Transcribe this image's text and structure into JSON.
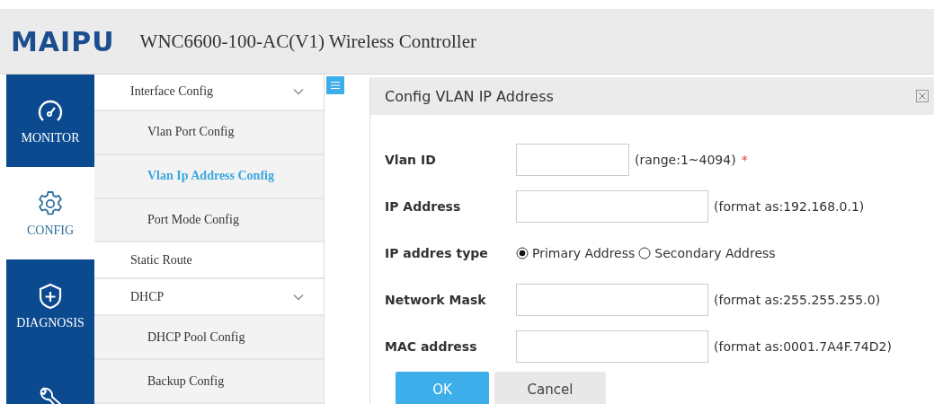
{
  "header": {
    "logo": "MAIPU",
    "title": "WNC6600-100-AC(V1) Wireless Controller"
  },
  "rail": [
    {
      "label": "MONITOR",
      "selected": false
    },
    {
      "label": "CONFIG",
      "selected": true
    },
    {
      "label": "DIAGNOSIS",
      "selected": false
    },
    {
      "selected": false
    }
  ],
  "menu": [
    {
      "label": "Interface Config",
      "expanded": true,
      "children": [
        {
          "label": "Vlan Port Config",
          "selected": false
        },
        {
          "label": "Vlan Ip Address Config",
          "selected": true
        },
        {
          "label": "Port Mode Config",
          "selected": false
        }
      ]
    },
    {
      "label": "Static Route"
    },
    {
      "label": "DHCP",
      "expanded": true,
      "children": [
        {
          "label": "DHCP Pool Config",
          "selected": false
        },
        {
          "label": "Backup Config",
          "selected": false
        }
      ]
    }
  ],
  "dialog": {
    "title": "Config VLAN IP Address",
    "fields": [
      {
        "kind": "short-input",
        "label": "Vlan ID",
        "hint": "(range:1~4094)",
        "required_mark": "*"
      },
      {
        "kind": "input",
        "label": "IP Address",
        "hint": "(format as:192.168.0.1)"
      },
      {
        "kind": "radio",
        "label": "IP addres type",
        "options": [
          {
            "label": "Primary Address",
            "selected": true
          },
          {
            "label": "Secondary Address",
            "selected": false
          }
        ]
      },
      {
        "kind": "input",
        "label": "Network Mask",
        "hint": "(format as:255.255.255.0)"
      },
      {
        "kind": "input",
        "label": "MAC address",
        "hint": "(format as:0001.7A4F.74D2)"
      }
    ],
    "buttons": [
      {
        "label": "OK",
        "kind": "primary"
      },
      {
        "label": "Cancel",
        "kind": "secondary"
      }
    ]
  }
}
